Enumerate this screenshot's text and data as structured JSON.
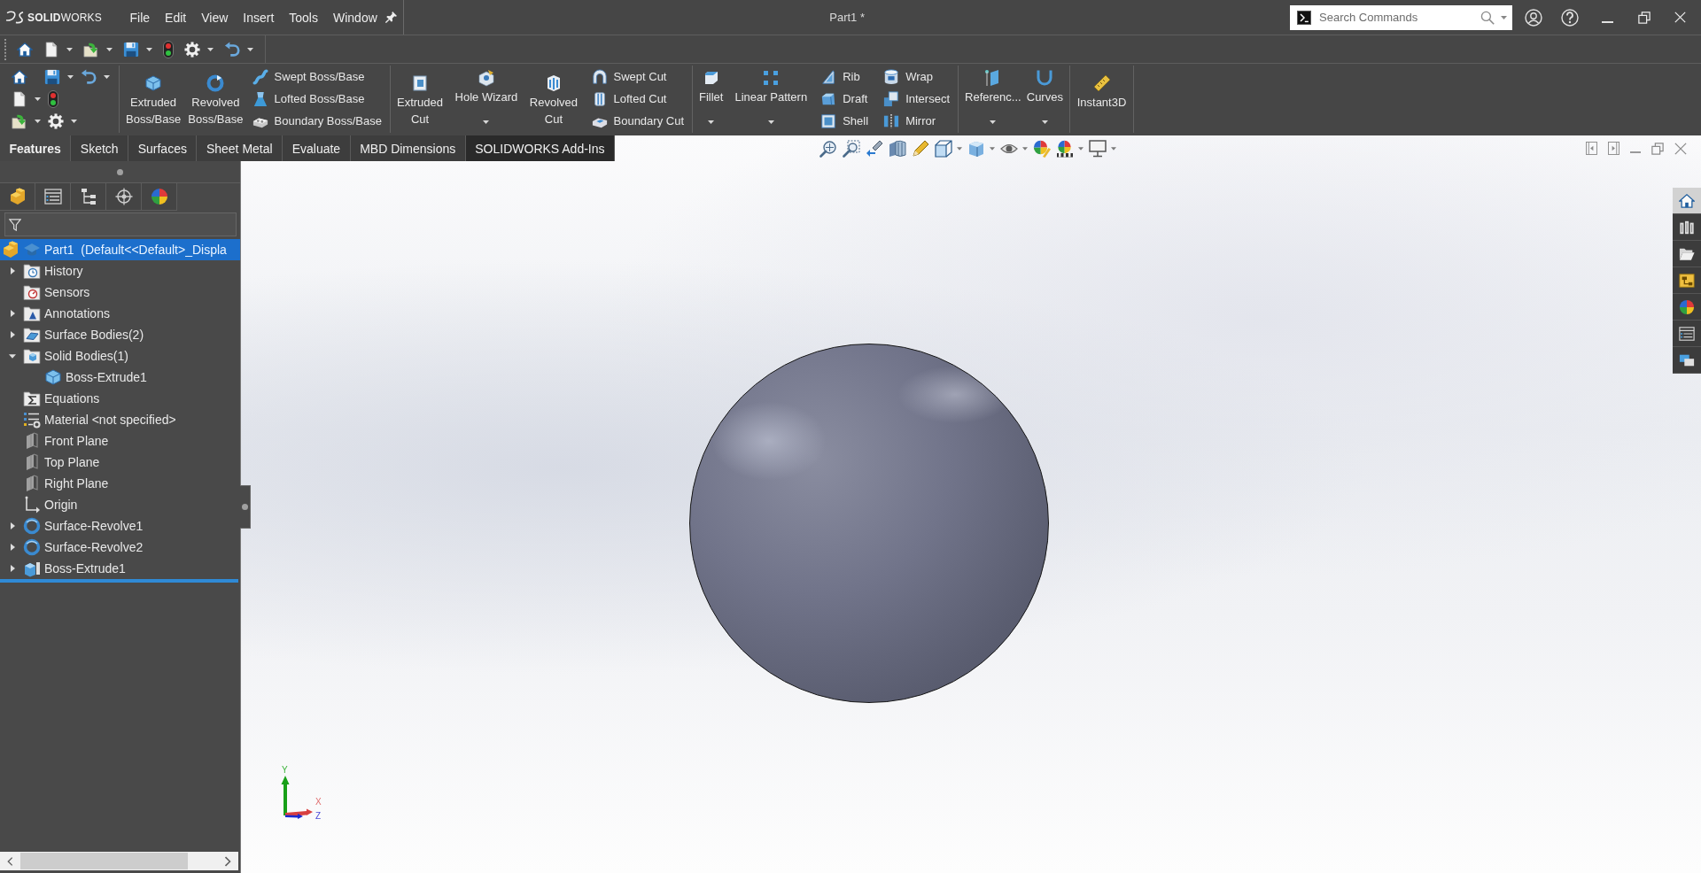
{
  "title_bar": {
    "logo": "**SOLID**WORKS",
    "menu": [
      "File",
      "Edit",
      "View",
      "Insert",
      "Tools",
      "Window"
    ],
    "document_title": "Part1 *",
    "search": {
      "placeholder": "Search Commands"
    }
  },
  "ribbon": {
    "groups": [
      {
        "items": [
          {
            "kind": "large",
            "label": "Extruded\nBoss/Base"
          },
          {
            "kind": "large",
            "label": "Revolved\nBoss/Base"
          },
          {
            "kind": "stack",
            "items": [
              {
                "label": "Swept Boss/Base"
              },
              {
                "label": "Lofted Boss/Base"
              },
              {
                "label": "Boundary Boss/Base"
              }
            ]
          }
        ]
      },
      {
        "items": [
          {
            "kind": "large",
            "label": "Extruded\nCut"
          },
          {
            "kind": "dropdown",
            "label": "Hole Wizard"
          },
          {
            "kind": "large",
            "label": "Revolved\nCut"
          },
          {
            "kind": "stack",
            "items": [
              {
                "label": "Swept Cut"
              },
              {
                "label": "Lofted Cut"
              },
              {
                "label": "Boundary Cut"
              }
            ]
          }
        ]
      },
      {
        "items": [
          {
            "kind": "dropdown",
            "label": "Fillet"
          },
          {
            "kind": "dropdown",
            "label": "Linear Pattern"
          },
          {
            "kind": "stack",
            "items": [
              {
                "label": "Rib"
              },
              {
                "label": "Draft"
              },
              {
                "label": "Shell"
              }
            ]
          },
          {
            "kind": "stack",
            "items": [
              {
                "label": "Wrap"
              },
              {
                "label": "Intersect"
              },
              {
                "label": "Mirror"
              }
            ]
          }
        ]
      },
      {
        "items": [
          {
            "kind": "dropdown",
            "label": "Referenc..."
          },
          {
            "kind": "dropdown",
            "label": "Curves"
          }
        ]
      },
      {
        "items": [
          {
            "kind": "large",
            "label": "Instant3D"
          }
        ]
      }
    ]
  },
  "command_tabs": [
    {
      "label": "Features",
      "selected": true,
      "hovered": false
    },
    {
      "label": "Sketch",
      "selected": false,
      "hovered": false
    },
    {
      "label": "Surfaces",
      "selected": false,
      "hovered": false
    },
    {
      "label": "Sheet Metal",
      "selected": false,
      "hovered": false
    },
    {
      "label": "Evaluate",
      "selected": false,
      "hovered": false
    },
    {
      "label": "MBD Dimensions",
      "selected": false,
      "hovered": false
    },
    {
      "label": "SOLIDWORKS Add-Ins",
      "selected": false,
      "hovered": true
    }
  ],
  "feature_tree": {
    "root": {
      "label": "Part1  (Default<<Default>_Displa",
      "selected": true
    },
    "items": [
      {
        "label": "History",
        "expanded": false,
        "selected": false
      },
      {
        "label": "Sensors",
        "selected": false
      },
      {
        "label": "Annotations",
        "expanded": false,
        "selected": false
      },
      {
        "label": "Surface Bodies(2)",
        "expanded": false,
        "selected": false
      },
      {
        "label": "Solid Bodies(1)",
        "expanded": true,
        "selected": false,
        "children": [
          {
            "label": "Boss-Extrude1",
            "selected": false
          }
        ]
      },
      {
        "label": "Equations",
        "selected": false
      },
      {
        "label": "Material <not specified>",
        "selected": false
      },
      {
        "label": "Front Plane",
        "selected": false
      },
      {
        "label": "Top Plane",
        "selected": false
      },
      {
        "label": "Right Plane",
        "selected": false
      },
      {
        "label": "Origin",
        "selected": false
      },
      {
        "label": "Surface-Revolve1",
        "expanded": false,
        "selected": false
      },
      {
        "label": "Surface-Revolve2",
        "expanded": false,
        "selected": false
      },
      {
        "label": "Boss-Extrude1",
        "expanded": false,
        "selected": false
      }
    ]
  },
  "task_pane": {
    "tabs": [
      {
        "selected": true
      },
      {
        "selected": false
      },
      {
        "selected": false
      },
      {
        "selected": false
      },
      {
        "selected": false
      },
      {
        "selected": false
      },
      {
        "selected": false
      }
    ]
  },
  "axis_triad": {
    "labels": [
      "Y",
      "X",
      "Z"
    ]
  }
}
